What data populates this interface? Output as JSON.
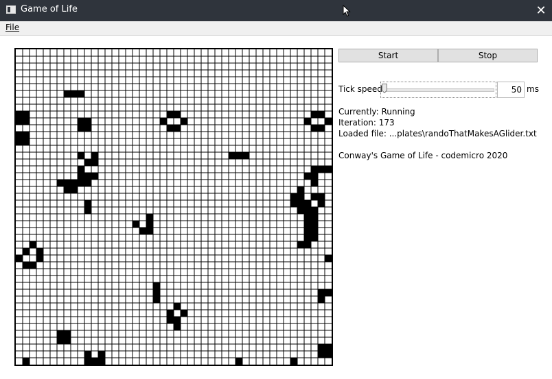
{
  "window": {
    "title": "Game of Life",
    "icon": "app-window-icon",
    "close_icon": "close-icon"
  },
  "menu": {
    "file": "File"
  },
  "controls": {
    "start": "Start",
    "stop": "Stop",
    "tick_label": "Tick speed",
    "tick_value": "50",
    "tick_unit": "ms",
    "slider_level_fraction": 0.0
  },
  "info": {
    "status": "Currently: Running",
    "iteration": "Iteration: 173",
    "loaded": "Loaded file: ...plates\\randoThatMakesAGlider.txt",
    "credit": "Conway's Game of Life - codemicro 2020"
  },
  "board": {
    "cols": 46,
    "rows": 46,
    "alive": [
      [
        7,
        6
      ],
      [
        8,
        6
      ],
      [
        9,
        6
      ],
      [
        0,
        9
      ],
      [
        1,
        9
      ],
      [
        0,
        10
      ],
      [
        1,
        10
      ],
      [
        22,
        9
      ],
      [
        23,
        9
      ],
      [
        43,
        9
      ],
      [
        44,
        9
      ],
      [
        9,
        10
      ],
      [
        10,
        10
      ],
      [
        21,
        10
      ],
      [
        24,
        10
      ],
      [
        42,
        10
      ],
      [
        45,
        10
      ],
      [
        9,
        11
      ],
      [
        10,
        11
      ],
      [
        22,
        11
      ],
      [
        23,
        11
      ],
      [
        43,
        11
      ],
      [
        44,
        11
      ],
      [
        0,
        12
      ],
      [
        1,
        12
      ],
      [
        0,
        13
      ],
      [
        1,
        13
      ],
      [
        9,
        15
      ],
      [
        11,
        15
      ],
      [
        31,
        15
      ],
      [
        32,
        15
      ],
      [
        33,
        15
      ],
      [
        10,
        16
      ],
      [
        11,
        16
      ],
      [
        44,
        17
      ],
      [
        45,
        17
      ],
      [
        9,
        17
      ],
      [
        43,
        17
      ],
      [
        9,
        18
      ],
      [
        10,
        18
      ],
      [
        11,
        18
      ],
      [
        42,
        18
      ],
      [
        43,
        18
      ],
      [
        6,
        19
      ],
      [
        7,
        19
      ],
      [
        8,
        19
      ],
      [
        9,
        19
      ],
      [
        10,
        19
      ],
      [
        43,
        19
      ],
      [
        7,
        20
      ],
      [
        8,
        20
      ],
      [
        41,
        20
      ],
      [
        40,
        21
      ],
      [
        41,
        21
      ],
      [
        43,
        21
      ],
      [
        44,
        21
      ],
      [
        10,
        22
      ],
      [
        40,
        22
      ],
      [
        41,
        22
      ],
      [
        42,
        22
      ],
      [
        44,
        22
      ],
      [
        10,
        23
      ],
      [
        41,
        23
      ],
      [
        42,
        23
      ],
      [
        43,
        23
      ],
      [
        42,
        24
      ],
      [
        43,
        24
      ],
      [
        19,
        24
      ],
      [
        17,
        25
      ],
      [
        19,
        25
      ],
      [
        42,
        25
      ],
      [
        43,
        25
      ],
      [
        18,
        26
      ],
      [
        19,
        26
      ],
      [
        42,
        26
      ],
      [
        43,
        26
      ],
      [
        42,
        27
      ],
      [
        43,
        27
      ],
      [
        2,
        28
      ],
      [
        41,
        28
      ],
      [
        42,
        28
      ],
      [
        1,
        29
      ],
      [
        3,
        29
      ],
      [
        0,
        30
      ],
      [
        3,
        30
      ],
      [
        45,
        30
      ],
      [
        1,
        31
      ],
      [
        2,
        31
      ],
      [
        20,
        34
      ],
      [
        20,
        35
      ],
      [
        44,
        35
      ],
      [
        45,
        35
      ],
      [
        20,
        36
      ],
      [
        44,
        36
      ],
      [
        23,
        37
      ],
      [
        22,
        38
      ],
      [
        24,
        38
      ],
      [
        22,
        39
      ],
      [
        23,
        39
      ],
      [
        23,
        40
      ],
      [
        6,
        41
      ],
      [
        7,
        41
      ],
      [
        6,
        42
      ],
      [
        7,
        42
      ],
      [
        44,
        43
      ],
      [
        45,
        43
      ],
      [
        10,
        44
      ],
      [
        12,
        44
      ],
      [
        44,
        44
      ],
      [
        45,
        44
      ],
      [
        1,
        45
      ],
      [
        10,
        45
      ],
      [
        11,
        45
      ],
      [
        12,
        45
      ],
      [
        32,
        45
      ],
      [
        40,
        45
      ]
    ]
  },
  "colors": {
    "titlebar": "#2f343c",
    "menubar": "#f0f0f0",
    "cell_alive": "#000000",
    "grid_line": "#000000",
    "button_face": "#e1e1e1",
    "button_border": "#adadad"
  }
}
